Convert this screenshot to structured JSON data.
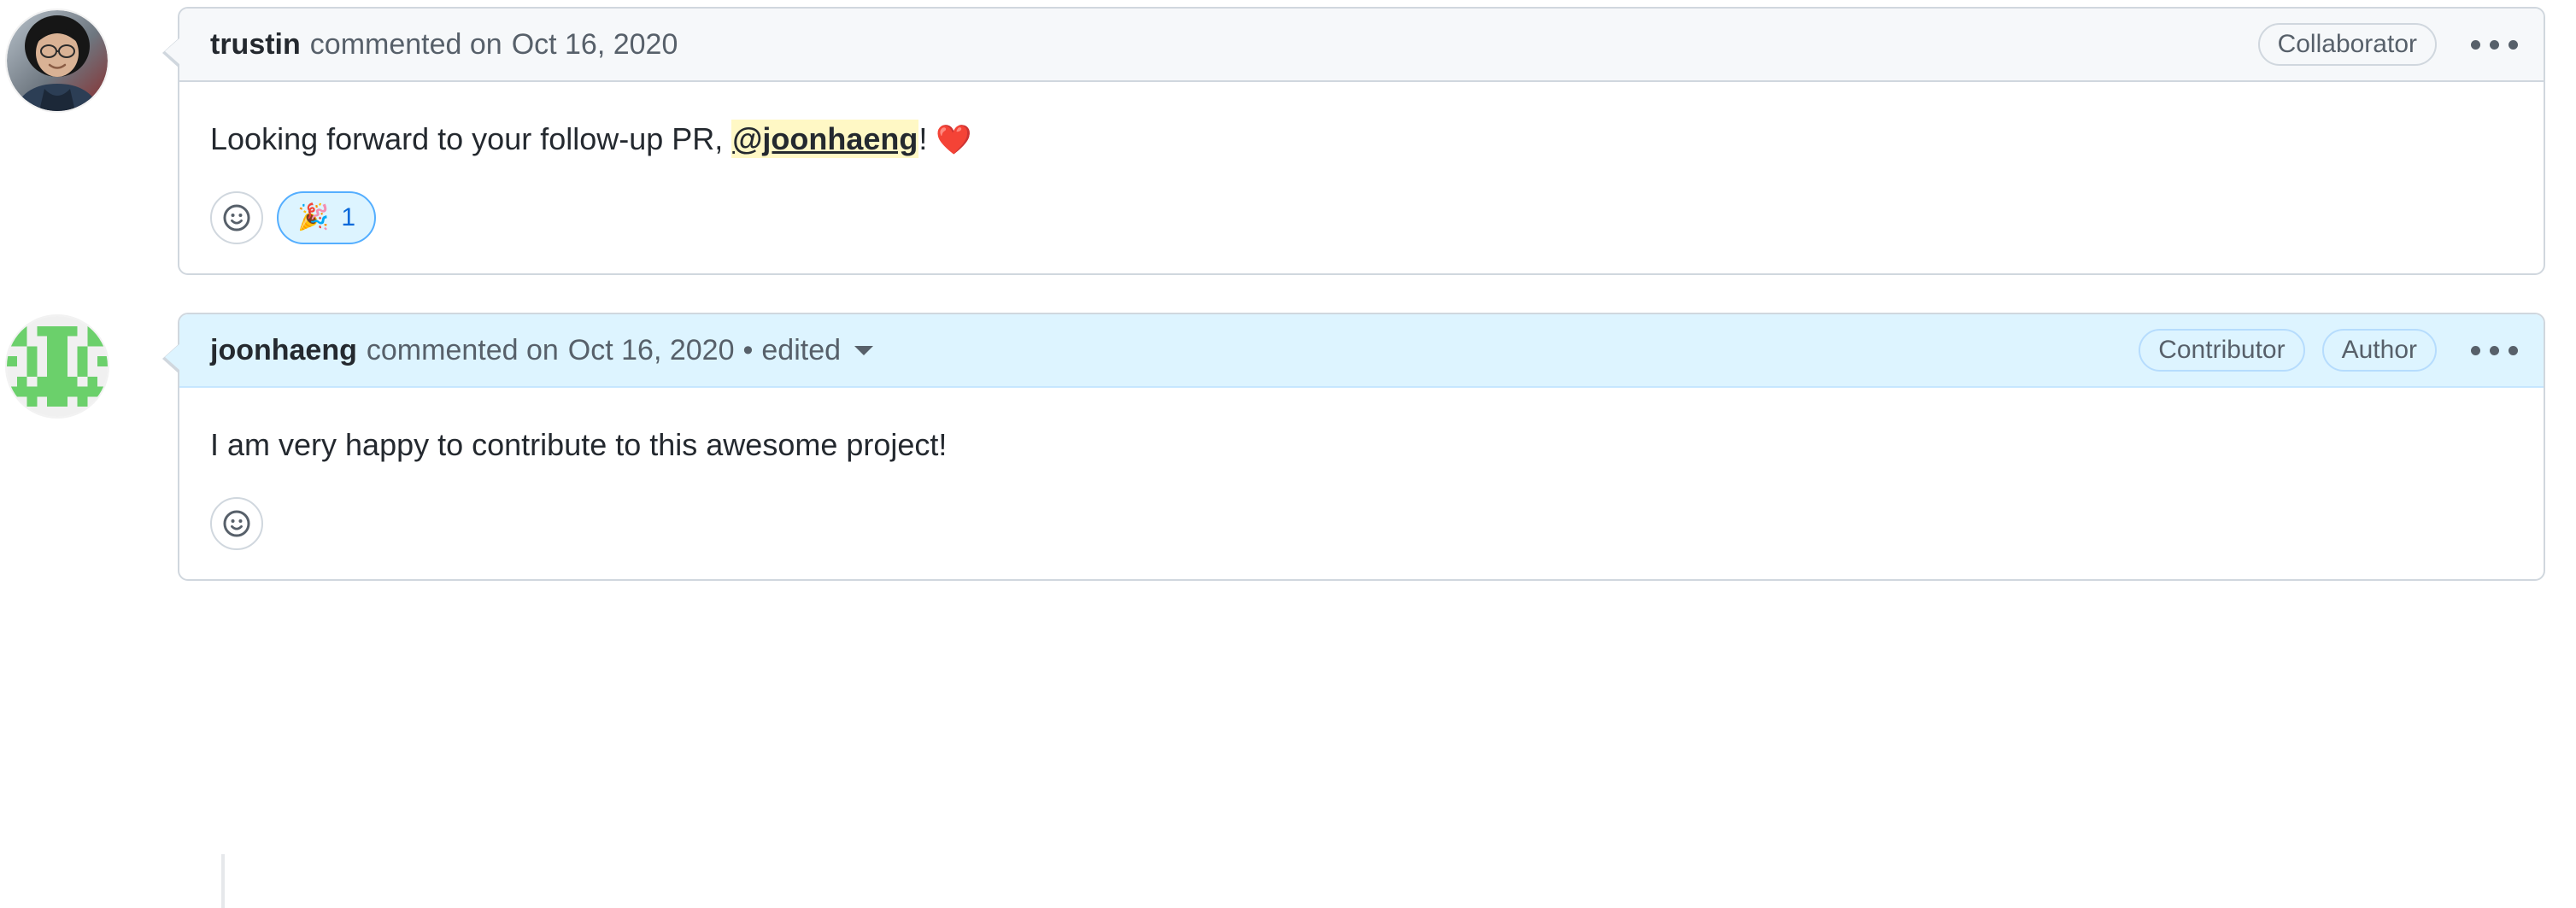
{
  "theme": {
    "page_bg": "#ffffff",
    "border": "#d0d7de",
    "header_bg": "#f6f8fa",
    "header_bg_highlight": "#ddf4ff",
    "text_primary": "#24292f",
    "text_muted": "#57606a",
    "accent_blue": "#0969da",
    "mention_highlight": "#fff8c5",
    "thread_line": "#e6e8eb"
  },
  "comments": [
    {
      "author": "trustin",
      "verb": "commented on",
      "timestamp": "Oct 16, 2020",
      "edited": false,
      "edited_label": "",
      "avatar_type": "photo-avatar",
      "badges": [
        "Collaborator"
      ],
      "menu_label": "•••",
      "body_segments": [
        {
          "type": "text",
          "text": "Looking forward to your follow-up PR, "
        },
        {
          "type": "mention",
          "text": "@joonhaeng"
        },
        {
          "type": "text",
          "text": "! "
        },
        {
          "type": "emoji",
          "text": "❤️"
        }
      ],
      "add_reaction_icon": "smiley-icon",
      "reactions": [
        {
          "emoji": "🎉",
          "name": "hooray-reaction",
          "count": "1",
          "active": true
        }
      ]
    },
    {
      "author": "joonhaeng",
      "verb": "commented on",
      "timestamp": "Oct 16, 2020",
      "edited": true,
      "edited_separator": "•",
      "edited_label": "edited",
      "avatar_type": "identicon-avatar",
      "badges": [
        "Contributor",
        "Author"
      ],
      "menu_label": "•••",
      "body_segments": [
        {
          "type": "text",
          "text": "I am very happy to contribute to this awesome project!"
        }
      ],
      "add_reaction_icon": "smiley-icon",
      "reactions": []
    }
  ]
}
